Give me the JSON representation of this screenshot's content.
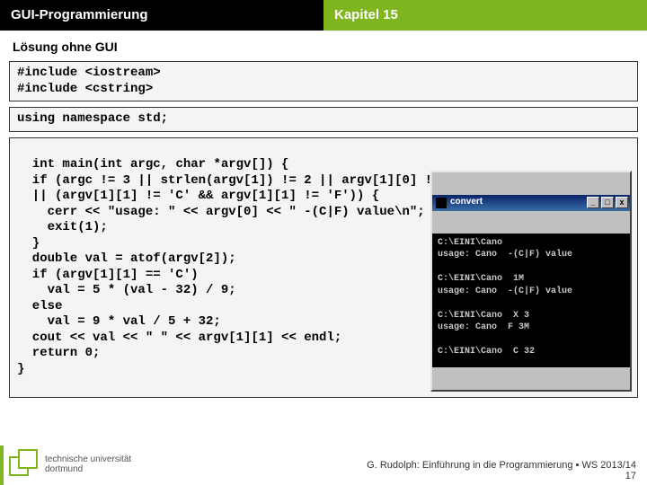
{
  "header": {
    "left": "GUI-Programmierung",
    "right": "Kapitel 15"
  },
  "subtitle": "Lösung ohne GUI",
  "code": {
    "block1": "#include <iostream>\n#include <cstring>",
    "block2": "using namespace std;",
    "block3": "int main(int argc, char *argv[]) {\n  if (argc != 3 || strlen(argv[1]) != 2 || argv[1][0] != '-,\n  || (argv[1][1] != 'C' && argv[1][1] != 'F')) {\n    cerr << \"usage: \" << argv[0] << \" -(C|F) value\\n\";\n    exit(1);\n  }\n  double val = atof(argv[2]);\n  if (argv[1][1] == 'C')\n    val = 5 * (val - 32) / 9;\n  else\n    val = 9 * val / 5 + 32;\n  cout << val << \" \" << argv[1][1] << endl;\n  return 0;\n}"
  },
  "console": {
    "title": "convert",
    "buttons": {
      "min": "_",
      "max": "□",
      "close": "x"
    },
    "body": "C:\\EINI\\Cano\nusage: Cano  -(C|F) value\n\nC:\\EINI\\Cano  1M\nusage: Cano  -(C|F) value\n\nC:\\EINI\\Cano  X 3\nusage: Cano  F 3M\n\nC:\\EINI\\Cano  C 32"
  },
  "footer": {
    "line1": "G. Rudolph: Einführung in die Programmierung ▪ WS 2013/14",
    "line2": "17"
  },
  "logo": {
    "l1": "technische universität",
    "l2": "dortmund"
  }
}
